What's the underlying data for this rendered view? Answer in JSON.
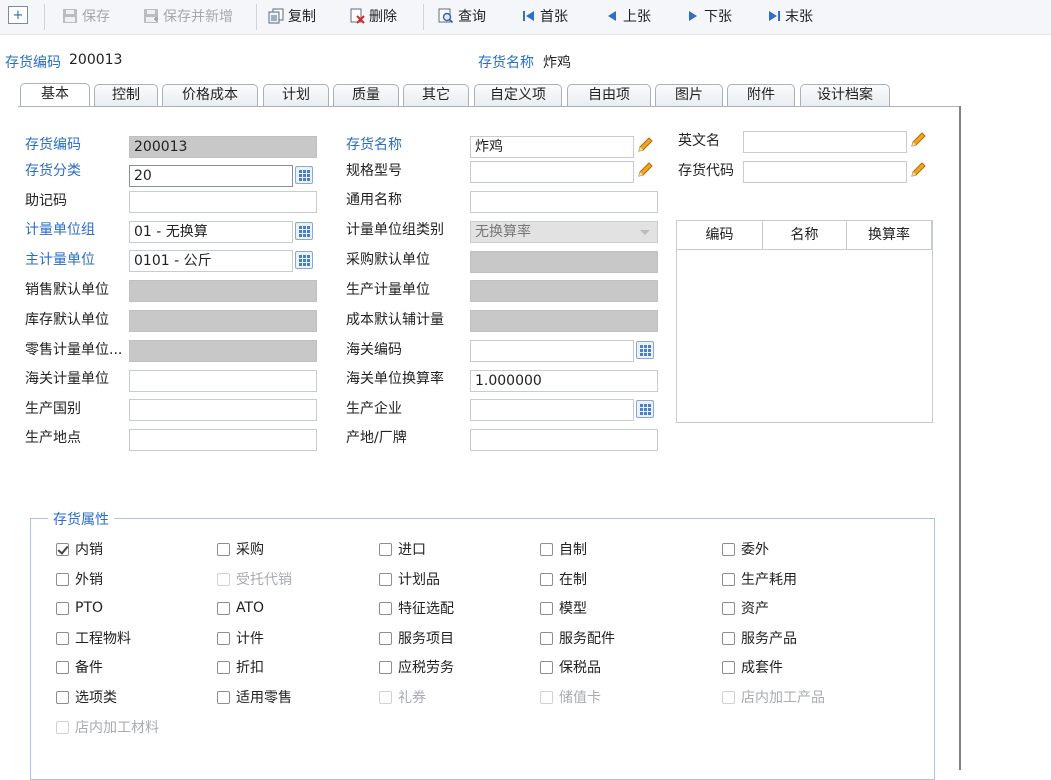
{
  "toolbar": {
    "save": "保存",
    "save_new": "保存并新增",
    "copy": "复制",
    "delete": "删除",
    "query": "查询",
    "first": "首张",
    "prev": "上张",
    "next": "下张",
    "last": "末张"
  },
  "header": {
    "code_label": "存货编码",
    "code_value": "200013",
    "name_label": "存货名称",
    "name_value": "炸鸡"
  },
  "tabs": [
    "基本",
    "控制",
    "价格成本",
    "计划",
    "质量",
    "其它",
    "自定义项",
    "自由项",
    "图片",
    "附件",
    "设计档案"
  ],
  "form": {
    "col1": [
      {
        "label": "存货编码",
        "value": "200013"
      },
      {
        "label": "存货分类",
        "value": "20"
      },
      {
        "label": "助记码",
        "value": ""
      },
      {
        "label": "计量单位组",
        "value": "01 - 无换算"
      },
      {
        "label": "主计量单位",
        "value": "0101 - 公斤"
      },
      {
        "label": "销售默认单位",
        "value": ""
      },
      {
        "label": "库存默认单位",
        "value": ""
      },
      {
        "label": "零售计量单位...",
        "value": ""
      },
      {
        "label": "海关计量单位",
        "value": ""
      },
      {
        "label": "生产国别",
        "value": ""
      },
      {
        "label": "生产地点",
        "value": ""
      }
    ],
    "col2": [
      {
        "label": "存货名称",
        "value": "炸鸡"
      },
      {
        "label": "规格型号",
        "value": ""
      },
      {
        "label": "通用名称",
        "value": ""
      },
      {
        "label": "计量单位组类别",
        "value": "无换算率"
      },
      {
        "label": "采购默认单位",
        "value": ""
      },
      {
        "label": "生产计量单位",
        "value": ""
      },
      {
        "label": "成本默认辅计量",
        "value": ""
      },
      {
        "label": "海关编码",
        "value": ""
      },
      {
        "label": "海关单位换算率",
        "value": "1.000000"
      },
      {
        "label": "生产企业",
        "value": ""
      },
      {
        "label": "产地/厂牌",
        "value": ""
      }
    ],
    "col3": [
      {
        "label": "英文名",
        "value": ""
      },
      {
        "label": "存货代码",
        "value": ""
      }
    ],
    "unit_grid_headers": [
      "编码",
      "名称",
      "换算率"
    ]
  },
  "attributes": {
    "title": "存货属性",
    "items": [
      {
        "label": "内销",
        "checked": true,
        "enabled": true
      },
      {
        "label": "采购",
        "checked": false,
        "enabled": true
      },
      {
        "label": "进口",
        "checked": false,
        "enabled": true
      },
      {
        "label": "自制",
        "checked": false,
        "enabled": true
      },
      {
        "label": "委外",
        "checked": false,
        "enabled": true
      },
      {
        "label": "外销",
        "checked": false,
        "enabled": true
      },
      {
        "label": "受托代销",
        "checked": false,
        "enabled": false
      },
      {
        "label": "计划品",
        "checked": false,
        "enabled": true
      },
      {
        "label": "在制",
        "checked": false,
        "enabled": true
      },
      {
        "label": "生产耗用",
        "checked": false,
        "enabled": true
      },
      {
        "label": "PTO",
        "checked": false,
        "enabled": true
      },
      {
        "label": "ATO",
        "checked": false,
        "enabled": true
      },
      {
        "label": "特征选配",
        "checked": false,
        "enabled": true
      },
      {
        "label": "模型",
        "checked": false,
        "enabled": true
      },
      {
        "label": "资产",
        "checked": false,
        "enabled": true
      },
      {
        "label": "工程物料",
        "checked": false,
        "enabled": true
      },
      {
        "label": "计件",
        "checked": false,
        "enabled": true
      },
      {
        "label": "服务项目",
        "checked": false,
        "enabled": true
      },
      {
        "label": "服务配件",
        "checked": false,
        "enabled": true
      },
      {
        "label": "服务产品",
        "checked": false,
        "enabled": true
      },
      {
        "label": "备件",
        "checked": false,
        "enabled": true
      },
      {
        "label": "折扣",
        "checked": false,
        "enabled": true
      },
      {
        "label": "应税劳务",
        "checked": false,
        "enabled": true
      },
      {
        "label": "保税品",
        "checked": false,
        "enabled": true
      },
      {
        "label": "成套件",
        "checked": false,
        "enabled": true
      },
      {
        "label": "选项类",
        "checked": false,
        "enabled": true
      },
      {
        "label": "适用零售",
        "checked": false,
        "enabled": true
      },
      {
        "label": "礼券",
        "checked": false,
        "enabled": false
      },
      {
        "label": "储值卡",
        "checked": false,
        "enabled": false
      },
      {
        "label": "店内加工产品",
        "checked": false,
        "enabled": false
      },
      {
        "label": "店内加工材料",
        "checked": false,
        "enabled": false
      }
    ]
  }
}
